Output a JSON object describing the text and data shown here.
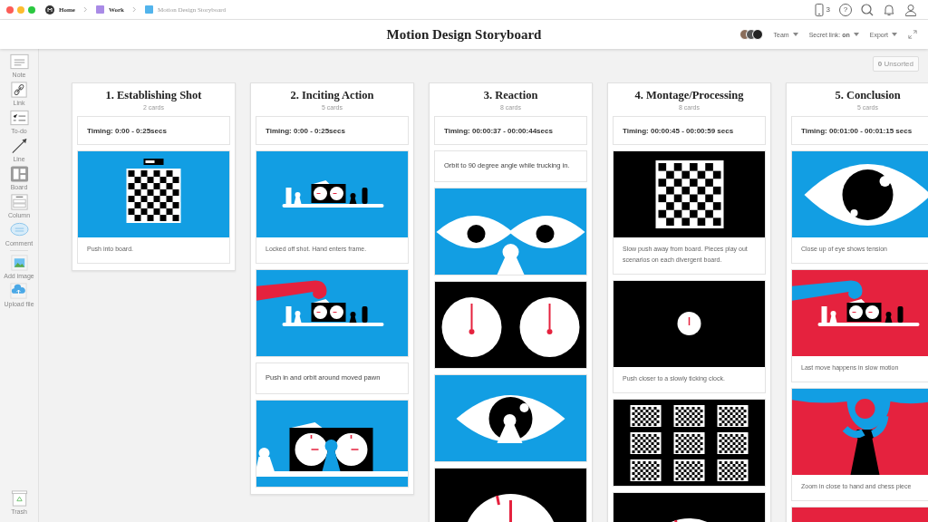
{
  "topbar": {
    "breadcrumbs": [
      {
        "label": "Home",
        "kind": "home"
      },
      {
        "label": "Work",
        "kind": "board",
        "color": "#a98be6"
      },
      {
        "label": "Motion Design Storyboard",
        "kind": "current",
        "color": "#52b4ec"
      }
    ],
    "device_count": "3",
    "help": "?"
  },
  "header": {
    "title": "Motion Design Storyboard",
    "team": "Team",
    "secret_link": "Secret link: **on**",
    "export": "Export"
  },
  "toolbar": {
    "items": [
      {
        "label": "Note",
        "kind": "note"
      },
      {
        "label": "Link",
        "kind": "link"
      },
      {
        "label": "To-do",
        "kind": "todo"
      },
      {
        "label": "Line",
        "kind": "line"
      },
      {
        "label": "Board",
        "kind": "board"
      },
      {
        "label": "Column",
        "kind": "column"
      },
      {
        "label": "Comment",
        "kind": "comment"
      },
      {
        "label": "Add image",
        "kind": "image"
      },
      {
        "label": "Upload file",
        "kind": "upload"
      }
    ],
    "trash": "Trash"
  },
  "unsorted": "**0** Unsorted",
  "columns": [
    {
      "title": "1. Establishing Shot",
      "count": "2 cards",
      "cards": [
        {
          "kind": "timing",
          "text": "Timing: 0:00 - 0:25secs"
        },
        {
          "kind": "image",
          "frame": {
            "kind": "chessboard",
            "color": "#129ee3"
          },
          "caption": "Push into board."
        }
      ]
    },
    {
      "title": "2. Inciting Action",
      "count": "5 cards",
      "cards": [
        {
          "kind": "timing",
          "text": "Timing: 0:00 - 0:25secs"
        },
        {
          "kind": "image",
          "frame": {
            "kind": "shelf",
            "color": "#129ee3"
          },
          "caption": "Locked off shot. Hand enters frame."
        },
        {
          "kind": "image",
          "frame": {
            "kind": "hand-shelf",
            "color": "#129ee3"
          }
        },
        {
          "kind": "text",
          "text": "Push in and orbit around moved pawn"
        },
        {
          "kind": "image",
          "frame": {
            "kind": "clock-pawn",
            "color": "#129ee3"
          }
        }
      ]
    },
    {
      "title": "3. Reaction",
      "count": "8 cards",
      "cards": [
        {
          "kind": "timing",
          "text": "Timing: 00:00:37 - 00:00:44secs"
        },
        {
          "kind": "text",
          "text": "Orbit to 90 degree angle while trucking in."
        },
        {
          "kind": "image",
          "frame": {
            "kind": "eyes",
            "color": "#129ee3"
          }
        },
        {
          "kind": "image",
          "frame": {
            "kind": "clocks",
            "color": "#000000"
          }
        },
        {
          "kind": "image",
          "frame": {
            "kind": "eye-pawn",
            "color": "#129ee3"
          }
        },
        {
          "kind": "image",
          "frame": {
            "kind": "clock",
            "color": "#000000"
          }
        }
      ]
    },
    {
      "title": "4. Montage/Processing",
      "count": "8 cards",
      "cards": [
        {
          "kind": "timing",
          "text": "Timing: 00:00:45 - 00:00:59 secs"
        },
        {
          "kind": "image",
          "frame": {
            "kind": "chessboard-large",
            "color": "#000000"
          },
          "caption": "Slow push away from board. Pieces play out scenarios on each divergent board."
        },
        {
          "kind": "image",
          "frame": {
            "kind": "small-clock",
            "color": "#000000"
          },
          "caption": "Push closer to a slowly ticking clock."
        },
        {
          "kind": "image",
          "frame": {
            "kind": "boards",
            "color": "#000000"
          }
        },
        {
          "kind": "image",
          "frame": {
            "kind": "clock",
            "color": "#000000"
          }
        }
      ]
    },
    {
      "title": "5. Conclusion",
      "count": "5 cards",
      "cards": [
        {
          "kind": "timing",
          "text": "Timing: 00:01:00 - 00:01:15 secs"
        },
        {
          "kind": "image",
          "frame": {
            "kind": "eye",
            "color": "#129ee3"
          },
          "caption": "Close up of eye shows tension"
        },
        {
          "kind": "image",
          "frame": {
            "kind": "hand-shelf",
            "color": "#e5223e"
          },
          "caption": "Last move happens in slow motion"
        },
        {
          "kind": "image",
          "frame": {
            "kind": "hand-pawn",
            "color": "#e5223e"
          },
          "caption": "Zoom in close to hand and chess piece"
        },
        {
          "kind": "image",
          "frame": {
            "kind": "blank",
            "color": "#e5223e"
          }
        }
      ]
    }
  ]
}
